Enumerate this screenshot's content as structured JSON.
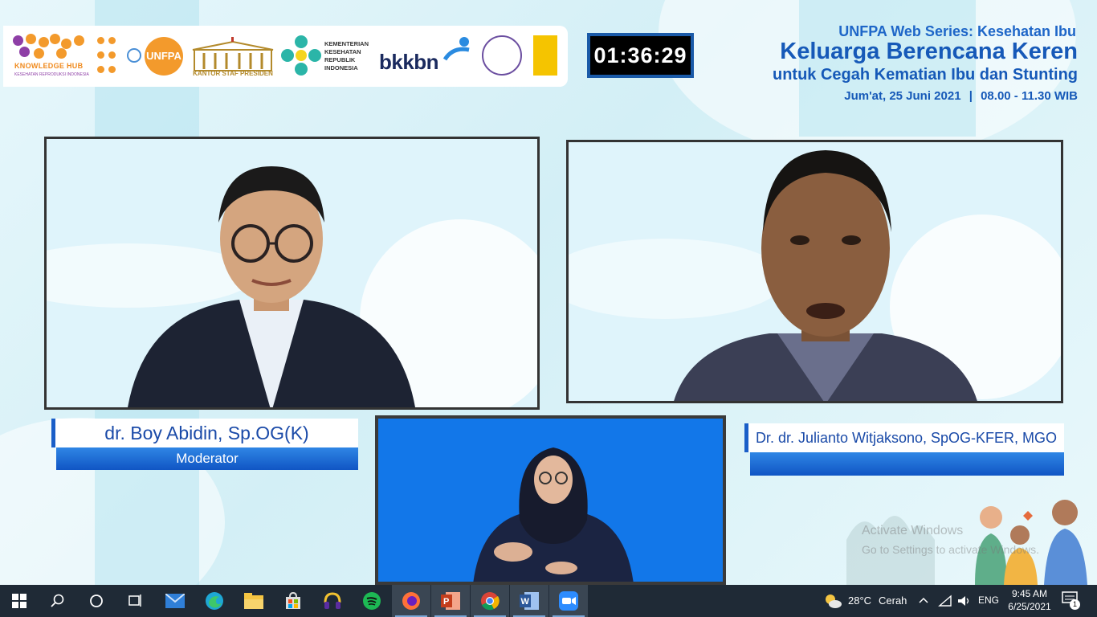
{
  "logos": {
    "knowledge_hub": "KNOWLEDGE HUB",
    "knowledge_hub_sub": "KESEHATAN REPRODUKSI INDONESIA",
    "unfpa": "UNFPA",
    "ksp": "KANTOR STAF PRESIDEN",
    "kemenkes": [
      "KEMENTERIAN",
      "KESEHATAN",
      "REPUBLIK",
      "INDONESIA"
    ],
    "bkkbn": "bkkbn"
  },
  "timer": "01:36:29",
  "event": {
    "series": "UNFPA Web Series: Kesehatan Ibu",
    "title_line1": "Keluarga Berencana Keren",
    "title_line2": "untuk Cegah Kematian Ibu dan Stunting",
    "date": "Jum'at, 25 Juni 2021",
    "time": "08.00 - 11.30 WIB"
  },
  "speakers": {
    "moderator": {
      "name": "dr. Boy Abidin, Sp.OG(K)",
      "role": "Moderator"
    },
    "speaker": {
      "name": "Dr. dr. Julianto Witjaksono, SpOG-KFER, MGO",
      "role": ""
    }
  },
  "watermark": {
    "line1": "Activate Windows",
    "line2": "Go to Settings to activate Windows."
  },
  "taskbar": {
    "weather_temp": "28°C",
    "weather_desc": "Cerah",
    "language": "ENG",
    "time": "9:45 AM",
    "date": "6/25/2021",
    "notification_count": "1",
    "apps": [
      "start-icon",
      "search-icon",
      "cortana-icon",
      "task-view-icon",
      "mail-icon",
      "edge-icon",
      "file-explorer-icon",
      "store-icon",
      "headset-app-icon",
      "spotify-icon",
      "firefox-icon",
      "powerpoint-icon",
      "chrome-icon",
      "word-icon",
      "zoom-icon"
    ]
  },
  "colors": {
    "accent_blue": "#1659b8",
    "orange": "#f39a2c",
    "taskbar": "#1f2a36"
  }
}
